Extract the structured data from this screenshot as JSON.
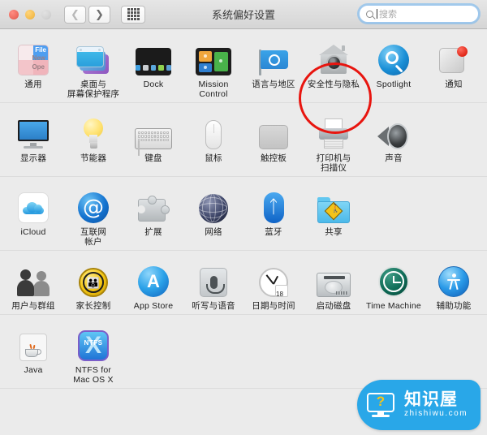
{
  "window": {
    "title": "系统偏好设置",
    "traffic_lights": [
      "close-red",
      "minimize-yellow",
      "zoom-green-disabled"
    ],
    "nav": {
      "back_icon": "chevron-left-icon",
      "forward_icon": "chevron-right-icon",
      "grid_icon": "show-all-grid-icon"
    }
  },
  "search": {
    "placeholder": "搜索",
    "icon": "search-icon",
    "focused": true
  },
  "annotation": {
    "shape": "circle",
    "color": "#e8150f",
    "targets": "安全性与隐私"
  },
  "watermark": {
    "cn": "知识屋",
    "en": "zhishiwu.com",
    "bg": "#29a7e8",
    "icon": "monitor-question-icon"
  },
  "rows": [
    {
      "items": [
        {
          "label": "通用",
          "icon": "general-icon"
        },
        {
          "label": "桌面与\n屏幕保护程序",
          "line1": "桌面与",
          "line2": "屏幕保护程序",
          "icon": "desktop-screensaver-icon"
        },
        {
          "label": "Dock",
          "icon": "dock-icon"
        },
        {
          "label": "Mission\nControl",
          "line1": "Mission",
          "line2": "Control",
          "icon": "mission-control-icon"
        },
        {
          "label": "语言与地区",
          "icon": "language-region-icon"
        },
        {
          "label": "安全性与隐私",
          "icon": "security-privacy-icon"
        },
        {
          "label": "Spotlight",
          "icon": "spotlight-icon"
        },
        {
          "label": "通知",
          "icon": "notifications-icon"
        }
      ]
    },
    {
      "items": [
        {
          "label": "显示器",
          "icon": "displays-icon"
        },
        {
          "label": "节能器",
          "icon": "energy-saver-icon"
        },
        {
          "label": "键盘",
          "icon": "keyboard-icon"
        },
        {
          "label": "鼠标",
          "icon": "mouse-icon"
        },
        {
          "label": "触控板",
          "icon": "trackpad-icon"
        },
        {
          "label": "打印机与\n扫描仪",
          "line1": "打印机与",
          "line2": "扫描仪",
          "icon": "printers-scanners-icon"
        },
        {
          "label": "声音",
          "icon": "sound-icon"
        }
      ]
    },
    {
      "items": [
        {
          "label": "iCloud",
          "icon": "icloud-icon"
        },
        {
          "label": "互联网\n帐户",
          "line1": "互联网",
          "line2": "帐户",
          "icon": "internet-accounts-icon"
        },
        {
          "label": "扩展",
          "icon": "extensions-icon"
        },
        {
          "label": "网络",
          "icon": "network-icon"
        },
        {
          "label": "蓝牙",
          "icon": "bluetooth-icon"
        },
        {
          "label": "共享",
          "icon": "sharing-icon"
        }
      ]
    },
    {
      "items": [
        {
          "label": "用户与群组",
          "icon": "users-groups-icon"
        },
        {
          "label": "家长控制",
          "icon": "parental-controls-icon"
        },
        {
          "label": "App Store",
          "icon": "app-store-icon"
        },
        {
          "label": "听写与语音",
          "icon": "dictation-speech-icon"
        },
        {
          "label": "日期与时间",
          "icon": "date-time-icon"
        },
        {
          "label": "启动磁盘",
          "icon": "startup-disk-icon"
        },
        {
          "label": "Time Machine",
          "icon": "time-machine-icon"
        },
        {
          "label": "辅助功能",
          "icon": "accessibility-icon"
        }
      ]
    },
    {
      "items": [
        {
          "label": "Java",
          "icon": "java-icon"
        },
        {
          "label": "NTFS for\nMac OS X",
          "line1": "NTFS for",
          "line2": "Mac OS X",
          "icon": "ntfs-mac-icon"
        }
      ]
    }
  ],
  "calendar_day": "18"
}
